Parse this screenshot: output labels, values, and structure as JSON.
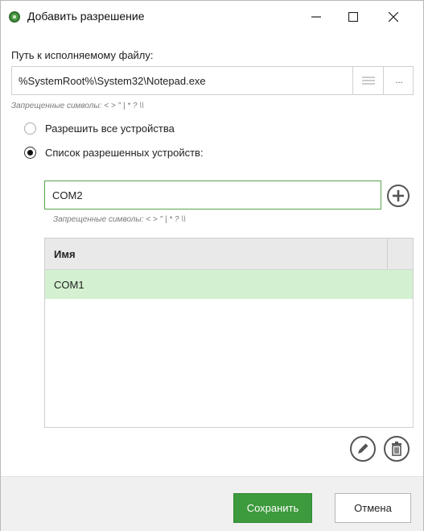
{
  "window": {
    "title": "Добавить разрешение"
  },
  "path": {
    "label": "Путь к исполняемому файлу:",
    "value": "%SystemRoot%\\System32\\Notepad.exe",
    "browse_label": "...",
    "hint": "Запрещенные символы: < > \" | * ? \\\\"
  },
  "radios": {
    "all_label": "Разрешить все устройства",
    "list_label": "Список разрешенных устройств:",
    "selected": "list"
  },
  "device": {
    "value": "COM2",
    "hint": "Запрещенные символы: < > \" | * ? \\\\"
  },
  "table": {
    "columns": [
      "Имя"
    ],
    "rows": [
      {
        "name": "COM1"
      }
    ]
  },
  "footer": {
    "save_label": "Сохранить",
    "cancel_label": "Отмена"
  },
  "colors": {
    "accent": "#3d9a3d",
    "selected_row": "#d3f0d0",
    "input_border": "#5aa64e"
  }
}
